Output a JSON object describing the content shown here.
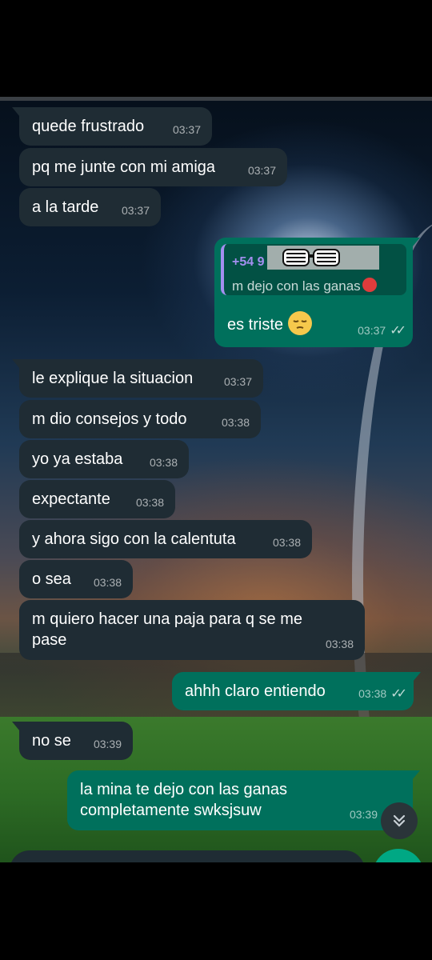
{
  "messages": [
    {
      "dir": "in",
      "text": "quede frustrado",
      "time": "03:37"
    },
    {
      "dir": "in",
      "text": "pq me junte con mi amiga",
      "time": "03:37"
    },
    {
      "dir": "in",
      "text": "a la tarde",
      "time": "03:37"
    },
    {
      "dir": "out",
      "reply": {
        "sender": "+54 9",
        "text": "m dejo con las ganas"
      },
      "text": "es triste",
      "time": "03:37"
    },
    {
      "dir": "in",
      "text": "le explique la situacion",
      "time": "03:37"
    },
    {
      "dir": "in",
      "text": "m dio consejos y todo",
      "time": "03:38"
    },
    {
      "dir": "in",
      "text": "yo ya estaba",
      "time": "03:38"
    },
    {
      "dir": "in",
      "text": "expectante",
      "time": "03:38"
    },
    {
      "dir": "in",
      "text": "y ahora sigo con la calentuta",
      "time": "03:38"
    },
    {
      "dir": "in",
      "text": "o sea",
      "time": "03:38"
    },
    {
      "dir": "in",
      "text": "m quiero hacer una paja para q se me pase",
      "time": "03:38"
    },
    {
      "dir": "out",
      "text": "ahhh claro entiendo",
      "time": "03:38"
    },
    {
      "dir": "in",
      "text": "no se",
      "time": "03:39"
    },
    {
      "dir": "out",
      "text": "la mina te dejo con las ganas completamente swksjsuw",
      "time": "03:39"
    }
  ],
  "read_ticks": "✓✓",
  "icons": {
    "scroll_down": "double-chevron-down-icon",
    "emoji_angry": "angry-face-emoji-icon",
    "emoji_pensive": "pensive-face-emoji-icon",
    "redaction": "sunglasses-sticker-icon"
  },
  "colors": {
    "incoming_bubble": "#1f2c34",
    "outgoing_bubble": "#00705c",
    "reply_accent": "#a48ff0",
    "fab": "#00a884"
  }
}
